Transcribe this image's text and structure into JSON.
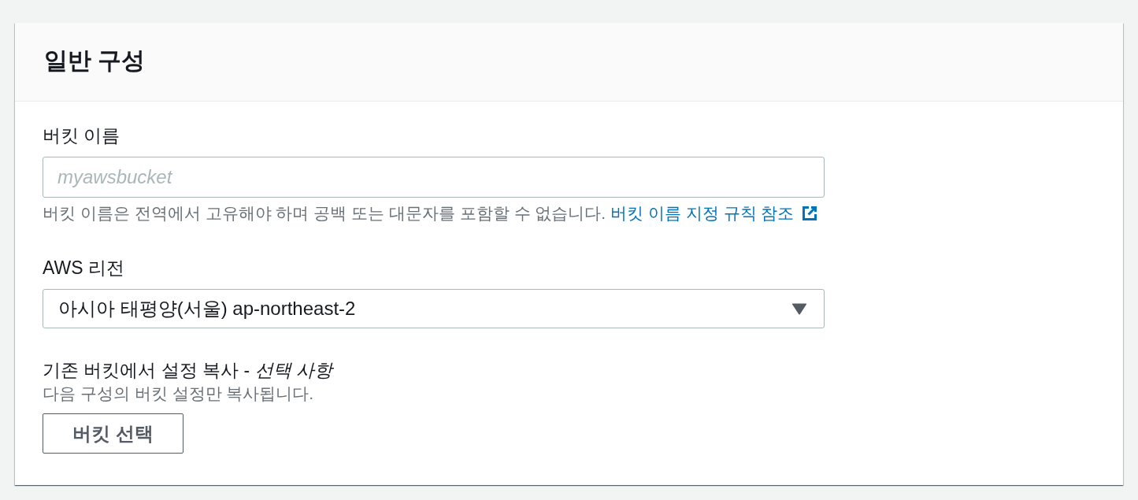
{
  "section": {
    "title": "일반 구성"
  },
  "fields": [
    {
      "kind": "text",
      "label": "버킷 이름",
      "placeholder": "myawsbucket",
      "help": "버킷 이름은 전역에서 고유해야 하며 공백 또는 대문자를 포함할 수 없습니다.",
      "link": "버킷 이름 지정 규칙 참조"
    },
    {
      "kind": "select",
      "label": "AWS 리전",
      "value": "아시아 태평양(서울) ap-northeast-2"
    },
    {
      "kind": "button",
      "label": "기존 버킷에서 설정 복사 - *선택 사항*",
      "description": "다음 구성의 버킷 설정만 복사됩니다.",
      "button": "버킷 선택"
    }
  ]
}
